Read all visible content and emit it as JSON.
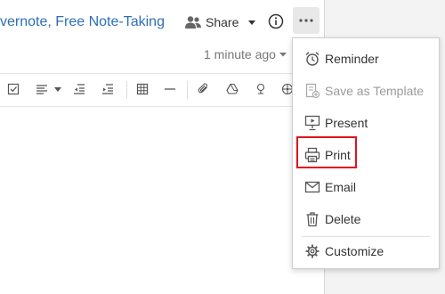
{
  "note": {
    "title": "vernote, Free Note-Taking",
    "share_label": "Share",
    "timestamp": "1 minute ago"
  },
  "menu": {
    "items": [
      {
        "label": "Reminder",
        "icon": "alarm-clock-icon",
        "enabled": true
      },
      {
        "label": "Save as Template",
        "icon": "template-icon",
        "enabled": false
      },
      {
        "label": "Present",
        "icon": "presentation-icon",
        "enabled": true
      },
      {
        "label": "Print",
        "icon": "printer-icon",
        "enabled": true,
        "highlighted": true
      },
      {
        "label": "Email",
        "icon": "envelope-icon",
        "enabled": true
      },
      {
        "label": "Delete",
        "icon": "trash-icon",
        "enabled": true
      },
      {
        "label": "Customize",
        "icon": "gear-icon",
        "enabled": true
      }
    ]
  },
  "colors": {
    "title_link": "#2d6fb7",
    "highlight": "#e0141e",
    "disabled_text": "#9a9a9a"
  }
}
